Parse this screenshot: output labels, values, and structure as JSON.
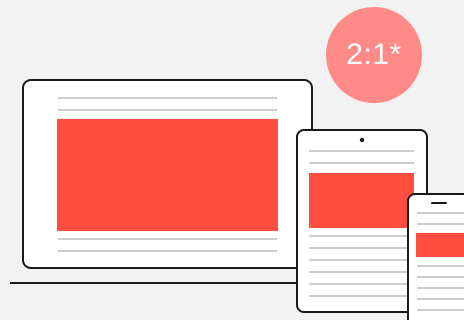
{
  "badge": {
    "text": "2:1*",
    "color": "#ff8a87"
  },
  "colors": {
    "background": "#f2f2f2",
    "media_block": "#ff4d40",
    "device_outline": "#1a1a1a",
    "device_fill": "#ffffff",
    "text_lines": "#9e9e9e"
  },
  "devices": [
    {
      "name": "laptop",
      "icon": "laptop-icon"
    },
    {
      "name": "tablet",
      "icon": "tablet-icon"
    },
    {
      "name": "phone",
      "icon": "phone-icon"
    }
  ]
}
